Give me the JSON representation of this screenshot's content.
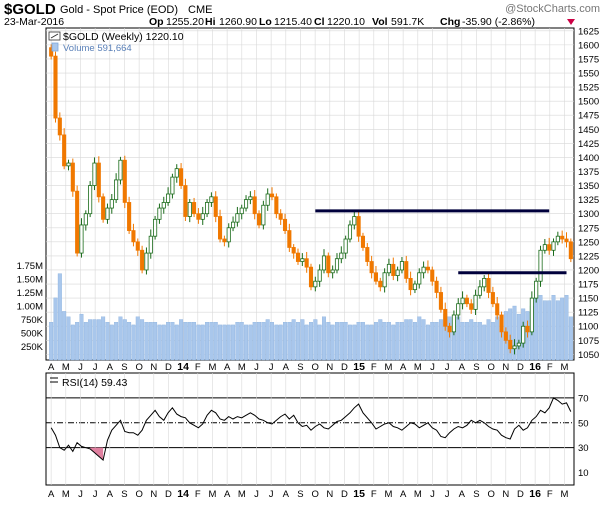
{
  "header": {
    "symbol": "$GOLD",
    "name": "Gold - Spot Price (EOD)",
    "exchange": "CME",
    "watermark": "@StockCharts.com",
    "date": "23-Mar-2016",
    "op_label": "Op",
    "op_value": "1255.20",
    "hi_label": "Hi",
    "hi_value": "1260.90",
    "lo_label": "Lo",
    "lo_value": "1215.40",
    "cl_label": "Cl",
    "cl_value": "1220.10",
    "vol_label": "Vol",
    "vol_value": "591.7K",
    "chg_label": "Chg",
    "chg_value": "-35.90 (-2.86%)"
  },
  "colors": {
    "up": "#1a6b1a",
    "down": "#f07800",
    "volume": "#a9c7ec",
    "volume_edge": "#7fa7d8",
    "rsi_line": "#000000",
    "rsi_oversold_fill": "#e080a0",
    "resistance_line": "#00003c",
    "grid": "#d8d8d8"
  },
  "chart_data": [
    {
      "type": "candlestick",
      "legend_label": "$GOLD (Weekly) 1220.10",
      "volume_legend_label": "Volume 591,664",
      "y_ticks": [
        "1050",
        "1075",
        "1100",
        "1125",
        "1150",
        "1175",
        "1200",
        "1225",
        "1250",
        "1275",
        "1300",
        "1325",
        "1350",
        "1375",
        "1400",
        "1425",
        "1450",
        "1475",
        "1500",
        "1525",
        "1550",
        "1575",
        "1600",
        "1625"
      ],
      "ylim": [
        1040,
        1630
      ],
      "volume_ticks": [
        "250K",
        "500K",
        "750K",
        "1.00M",
        "1.25M",
        "1.50M",
        "1.75M"
      ],
      "volume_lim": [
        0,
        2000000
      ],
      "x_labels": [
        "A",
        "M",
        "J",
        "J",
        "A",
        "S",
        "O",
        "N",
        "D",
        "14",
        "F",
        "M",
        "A",
        "M",
        "J",
        "J",
        "A",
        "S",
        "O",
        "N",
        "D",
        "15",
        "F",
        "M",
        "A",
        "M",
        "J",
        "J",
        "A",
        "S",
        "O",
        "N",
        "D",
        "16",
        "F",
        "M"
      ],
      "bold_x_labels": [
        "14",
        "15",
        "16"
      ],
      "weekly_close": [
        1580,
        1470,
        1440,
        1385,
        1390,
        1340,
        1230,
        1280,
        1300,
        1350,
        1390,
        1330,
        1290,
        1310,
        1325,
        1360,
        1395,
        1320,
        1270,
        1250,
        1235,
        1200,
        1230,
        1260,
        1290,
        1310,
        1320,
        1335,
        1365,
        1380,
        1350,
        1295,
        1320,
        1300,
        1290,
        1300,
        1320,
        1330,
        1295,
        1255,
        1250,
        1275,
        1285,
        1300,
        1310,
        1325,
        1330,
        1300,
        1280,
        1315,
        1335,
        1330,
        1300,
        1290,
        1270,
        1240,
        1230,
        1215,
        1220,
        1205,
        1170,
        1180,
        1200,
        1225,
        1195,
        1200,
        1220,
        1230,
        1255,
        1280,
        1295,
        1260,
        1240,
        1215,
        1195,
        1180,
        1170,
        1195,
        1210,
        1190,
        1200,
        1215,
        1185,
        1165,
        1175,
        1195,
        1205,
        1200,
        1180,
        1160,
        1130,
        1100,
        1090,
        1120,
        1140,
        1150,
        1140,
        1130,
        1155,
        1170,
        1185,
        1160,
        1140,
        1120,
        1090,
        1075,
        1060,
        1065,
        1070,
        1100,
        1090,
        1150,
        1180,
        1235,
        1245,
        1235,
        1250,
        1260,
        1255,
        1250,
        1220
      ],
      "weekly_volume": [
        700,
        1150,
        1600,
        900,
        800,
        650,
        700,
        850,
        700,
        750,
        750,
        750,
        800,
        700,
        650,
        700,
        800,
        750,
        700,
        650,
        800,
        750,
        700,
        700,
        700,
        650,
        650,
        700,
        700,
        650,
        750,
        700,
        700,
        700,
        650,
        650,
        700,
        700,
        700,
        650,
        650,
        650,
        650,
        700,
        700,
        650,
        650,
        700,
        700,
        700,
        750,
        700,
        650,
        650,
        700,
        700,
        750,
        700,
        750,
        650,
        700,
        750,
        650,
        800,
        700,
        650,
        700,
        700,
        700,
        650,
        650,
        700,
        700,
        650,
        650,
        700,
        750,
        700,
        700,
        650,
        700,
        700,
        750,
        750,
        700,
        800,
        750,
        650,
        700,
        700,
        750,
        850,
        800,
        750,
        800,
        700,
        700,
        750,
        700,
        700,
        650,
        750,
        700,
        800,
        700,
        900,
        950,
        1000,
        850,
        950,
        900,
        1000,
        1150,
        1200,
        1100,
        1100,
        1200,
        1100,
        1150,
        1200,
        800
      ],
      "resistance_levels": [
        {
          "value": 1305,
          "from_week": 61,
          "to_week": 115
        },
        {
          "value": 1195,
          "from_week": 94,
          "to_week": 119
        }
      ]
    },
    {
      "type": "line",
      "legend_label": "RSI(14) 59.43",
      "y_ticks": [
        "10",
        "30",
        "50",
        "70"
      ],
      "ylim": [
        0,
        90
      ],
      "reference_lines": [
        30,
        50,
        70
      ],
      "x_labels": [
        "A",
        "M",
        "J",
        "J",
        "A",
        "S",
        "O",
        "N",
        "D",
        "14",
        "F",
        "M",
        "A",
        "M",
        "J",
        "J",
        "A",
        "S",
        "O",
        "N",
        "D",
        "15",
        "F",
        "M",
        "A",
        "M",
        "J",
        "J",
        "A",
        "S",
        "O",
        "N",
        "D",
        "16",
        "F",
        "M"
      ],
      "bold_x_labels": [
        "14",
        "15",
        "16"
      ],
      "values": [
        46,
        40,
        30,
        28,
        32,
        27,
        34,
        31,
        30,
        29,
        26,
        23,
        20,
        36,
        44,
        48,
        52,
        43,
        42,
        42,
        40,
        44,
        52,
        56,
        60,
        55,
        52,
        58,
        62,
        57,
        55,
        54,
        50,
        48,
        46,
        49,
        56,
        60,
        58,
        53,
        52,
        55,
        53,
        55,
        54,
        56,
        58,
        56,
        53,
        52,
        50,
        49,
        52,
        55,
        57,
        53,
        56,
        50,
        47,
        48,
        44,
        47,
        49,
        46,
        45,
        48,
        51,
        52,
        55,
        58,
        62,
        65,
        58,
        54,
        50,
        45,
        47,
        49,
        50,
        47,
        46,
        44,
        47,
        50,
        49,
        46,
        48,
        50,
        46,
        44,
        39,
        38,
        42,
        45,
        47,
        46,
        48,
        52,
        50,
        52,
        50,
        47,
        45,
        44,
        40,
        38,
        37,
        45,
        48,
        44,
        46,
        52,
        55,
        60,
        58,
        62,
        70,
        68,
        65,
        66,
        59
      ]
    }
  ]
}
